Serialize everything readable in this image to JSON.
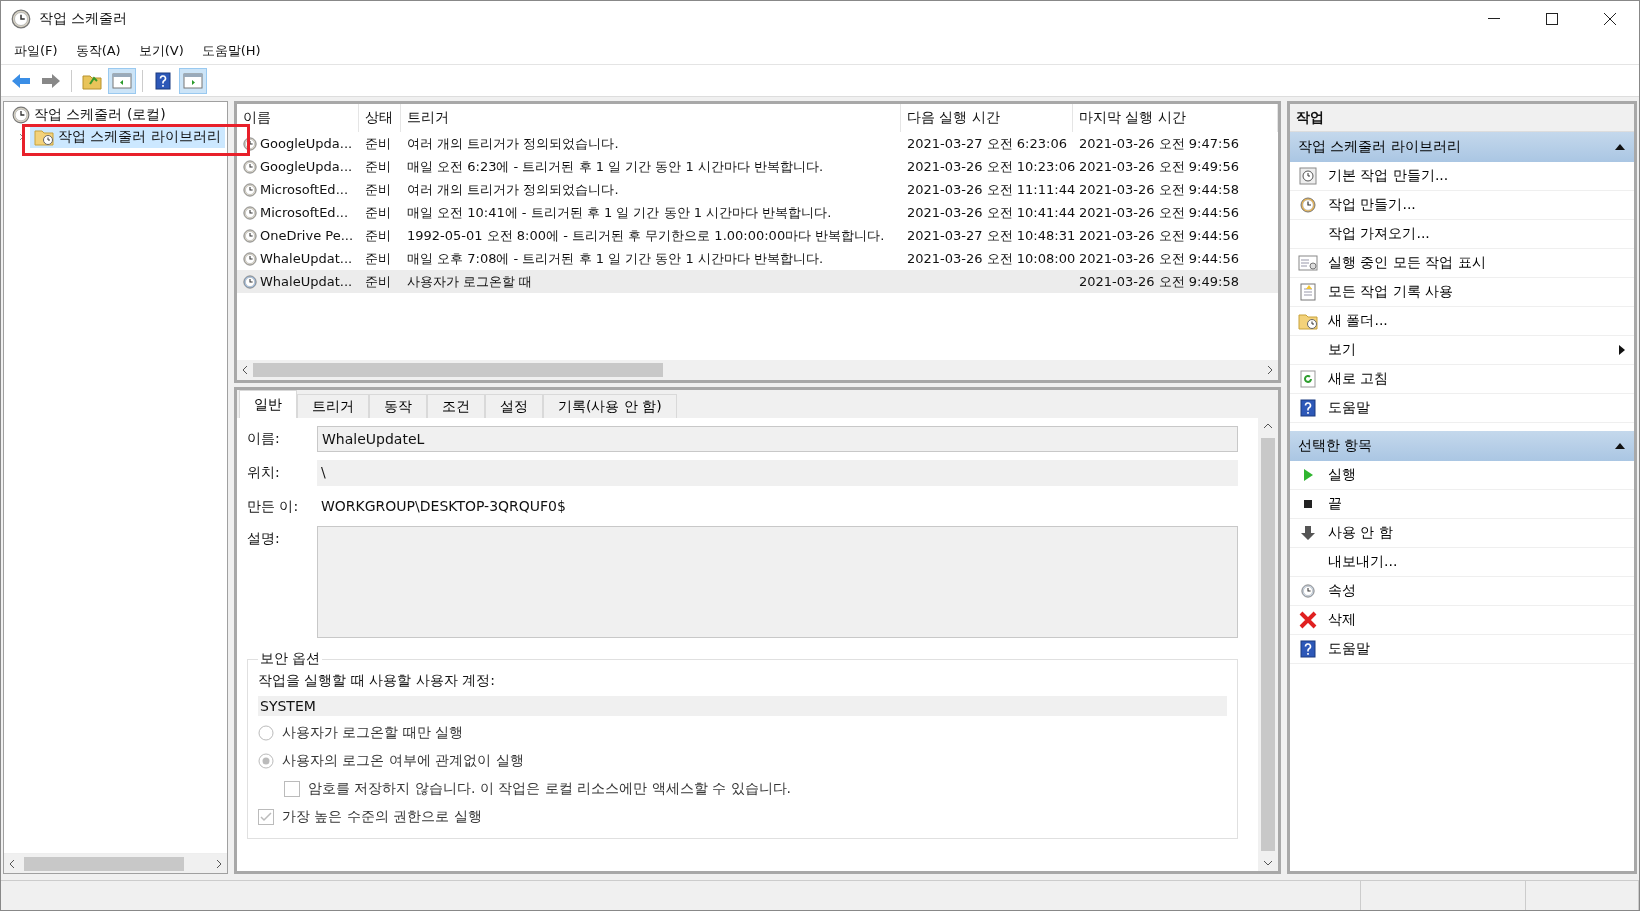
{
  "window": {
    "title": "작업 스케줄러"
  },
  "menu": [
    "파일(F)",
    "동작(A)",
    "보기(V)",
    "도움말(H)"
  ],
  "toolbar": [
    {
      "pressed": false
    },
    {
      "pressed": false
    },
    {
      "pressed": false
    },
    {
      "pressed": true
    },
    {
      "pressed": false
    },
    {
      "pressed": true
    }
  ],
  "tree": [
    {
      "label": "작업 스케줄러 (로컬)",
      "selected": false,
      "children": [
        {
          "label": "작업 스케줄러 라이브러리",
          "selected": true,
          "expanded": false
        }
      ]
    }
  ],
  "table": {
    "columns": [
      "이름",
      "상태",
      "트리거",
      "다음 실행 시간",
      "마지막 실행 시간"
    ],
    "rows": [
      {
        "cells": [
          "GoogleUpda...",
          "준비",
          "여러 개의 트리거가 정의되었습니다.",
          "2021-03-27 오전 6:23:06",
          "2021-03-26 오전 9:47:56"
        ],
        "selected": false
      },
      {
        "cells": [
          "GoogleUpda...",
          "준비",
          "매일 오전 6:23에 - 트리거된 후 1 일 기간 동안 1 시간마다 반복합니다.",
          "2021-03-26 오전 10:23:06",
          "2021-03-26 오전 9:49:56"
        ],
        "selected": false
      },
      {
        "cells": [
          "MicrosoftEd...",
          "준비",
          "여러 개의 트리거가 정의되었습니다.",
          "2021-03-26 오전 11:11:44",
          "2021-03-26 오전 9:44:58"
        ],
        "selected": false
      },
      {
        "cells": [
          "MicrosoftEd...",
          "준비",
          "매일 오전 10:41에 - 트리거된 후 1 일 기간 동안 1 시간마다 반복합니다.",
          "2021-03-26 오전 10:41:44",
          "2021-03-26 오전 9:44:56"
        ],
        "selected": false
      },
      {
        "cells": [
          "OneDrive Pe...",
          "준비",
          "1992-05-01 오전 8:00에 - 트리거된 후 무기한으로 1.00:00:00마다 반복합니다.",
          "2021-03-27 오전 10:48:31",
          "2021-03-26 오전 9:44:56"
        ],
        "selected": false
      },
      {
        "cells": [
          "WhaleUpdat...",
          "준비",
          "매일 오후 7:08에 - 트리거된 후 1 일 기간 동안 1 시간마다 반복합니다.",
          "2021-03-26 오전 10:08:00",
          "2021-03-26 오전 9:44:56"
        ],
        "selected": false
      },
      {
        "cells": [
          "WhaleUpdat...",
          "준비",
          "사용자가 로그온할 때",
          "",
          "2021-03-26 오전 9:49:58"
        ],
        "selected": true
      }
    ]
  },
  "tabs": [
    {
      "label": "일반",
      "selected": true
    },
    {
      "label": "트리거",
      "selected": false
    },
    {
      "label": "동작",
      "selected": false
    },
    {
      "label": "조건",
      "selected": false
    },
    {
      "label": "설정",
      "selected": false
    },
    {
      "label": "기록(사용 안 함)",
      "selected": false
    }
  ],
  "general": {
    "name_label": "이름:",
    "name_value": "WhaleUpdateL",
    "location_label": "위치:",
    "location_value": "\\",
    "author_label": "만든 이:",
    "author_value": "WORKGROUP\\DESKTOP-3QRQUF0$",
    "description_label": "설명:"
  },
  "security": {
    "title": "보안 옵션",
    "account_label": "작업을 실행할 때 사용할 사용자 계정:",
    "account_value": "SYSTEM",
    "options": [
      {
        "kind": "radio",
        "label": "사용자가 로그온할 때만 실행",
        "selected": false,
        "disabled": true
      },
      {
        "kind": "radio",
        "label": "사용자의 로그온 여부에 관계없이 실행",
        "selected": true,
        "disabled": true
      },
      {
        "kind": "checkbox",
        "label": "암호를 저장하지 않습니다. 이 작업은 로컬 리소스에만 액세스할 수 있습니다.",
        "checked": false,
        "disabled": true,
        "indented": true
      },
      {
        "kind": "checkbox",
        "label": "가장 높은 수준의 권한으로 실행",
        "checked": true,
        "disabled": true,
        "indented": false
      }
    ]
  },
  "actions": {
    "title": "작업",
    "sections": [
      {
        "title": "작업 스케줄러 라이브러리",
        "expanded": true,
        "items": [
          {
            "label": "기본 작업 만들기...",
            "submenu": false
          },
          {
            "label": "작업 만들기...",
            "submenu": false
          },
          {
            "label": "작업 가져오기...",
            "submenu": false
          },
          {
            "label": "실행 중인 모든 작업 표시",
            "submenu": false
          },
          {
            "label": "모든 작업 기록 사용",
            "submenu": false
          },
          {
            "label": "새 폴더...",
            "submenu": false
          },
          {
            "label": "보기",
            "submenu": true
          },
          {
            "label": "새로 고침",
            "submenu": false
          },
          {
            "label": "도움말",
            "submenu": false
          }
        ]
      },
      {
        "title": "선택한 항목",
        "expanded": true,
        "items": [
          {
            "label": "실행",
            "submenu": false
          },
          {
            "label": "끝",
            "submenu": false
          },
          {
            "label": "사용 안 함",
            "submenu": false
          },
          {
            "label": "내보내기...",
            "submenu": false
          },
          {
            "label": "속성",
            "submenu": false
          },
          {
            "label": "삭제",
            "submenu": false
          },
          {
            "label": "도움말",
            "submenu": false
          }
        ]
      }
    ]
  }
}
